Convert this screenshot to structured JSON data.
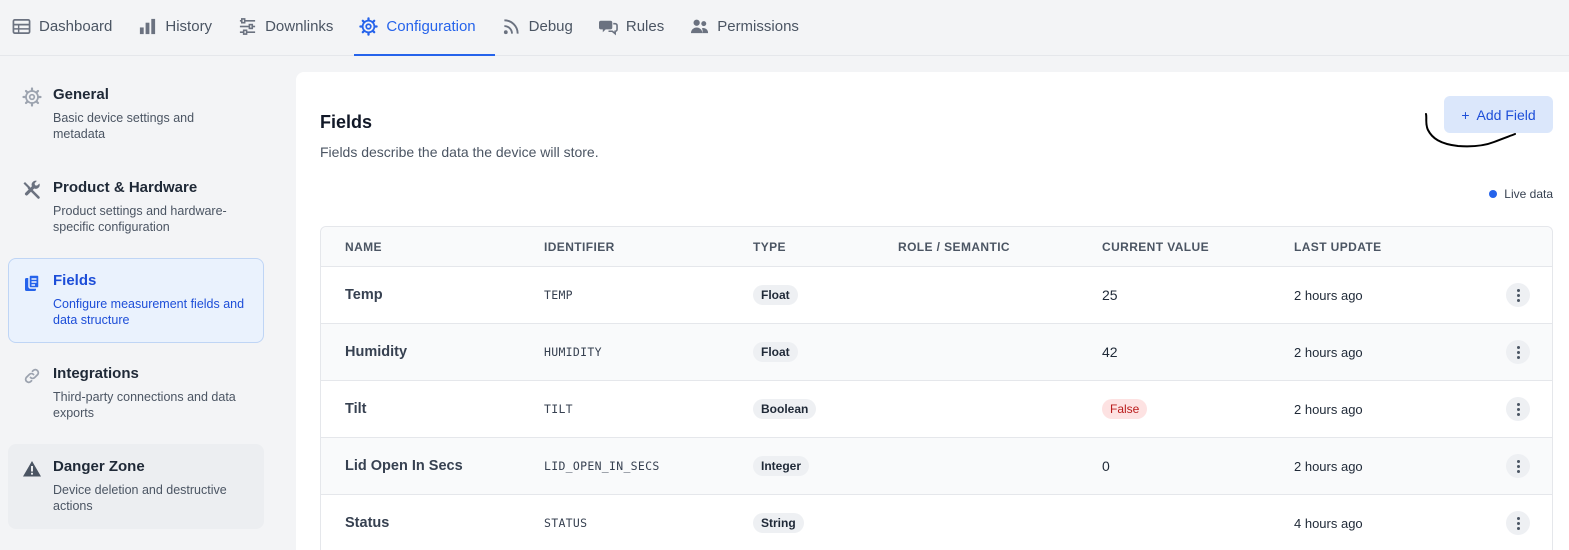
{
  "tabs": [
    {
      "label": "Dashboard",
      "icon": "table-icon",
      "active": false
    },
    {
      "label": "History",
      "icon": "bar-chart-icon",
      "active": false
    },
    {
      "label": "Downlinks",
      "icon": "sliders-icon",
      "active": false
    },
    {
      "label": "Configuration",
      "icon": "gear-icon",
      "active": true
    },
    {
      "label": "Debug",
      "icon": "rss-icon",
      "active": false
    },
    {
      "label": "Rules",
      "icon": "comments-icon",
      "active": false
    },
    {
      "label": "Permissions",
      "icon": "users-icon",
      "active": false
    }
  ],
  "sidebar": {
    "items": [
      {
        "title": "General",
        "desc": "Basic device settings and metadata",
        "icon": "gear-icon"
      },
      {
        "title": "Product & Hardware",
        "desc": "Product settings and hardware-specific configuration",
        "icon": "tools-icon"
      },
      {
        "title": "Fields",
        "desc": "Configure measurement fields and data structure",
        "icon": "fields-icon",
        "active": true
      },
      {
        "title": "Integrations",
        "desc": "Third-party connections and data exports",
        "icon": "link-icon"
      },
      {
        "title": "Danger Zone",
        "desc": "Device deletion and destructive actions",
        "icon": "warning-icon"
      }
    ]
  },
  "main": {
    "title": "Fields",
    "subtitle": "Fields describe the data the device will store.",
    "add_button": "Add Field",
    "add_button_icon": "+",
    "live_label": "Live data",
    "table": {
      "columns": [
        "NAME",
        "IDENTIFIER",
        "TYPE",
        "ROLE / SEMANTIC",
        "CURRENT VALUE",
        "LAST UPDATE"
      ],
      "rows": [
        {
          "name": "Temp",
          "identifier": "TEMP",
          "type": "Float",
          "role": "",
          "value": "25",
          "updated": "2 hours ago"
        },
        {
          "name": "Humidity",
          "identifier": "HUMIDITY",
          "type": "Float",
          "role": "",
          "value": "42",
          "updated": "2 hours ago"
        },
        {
          "name": "Tilt",
          "identifier": "TILT",
          "type": "Boolean",
          "role": "",
          "value": "False",
          "value_style": "false-pill",
          "updated": "2 hours ago"
        },
        {
          "name": "Lid Open In Secs",
          "identifier": "LID_OPEN_IN_SECS",
          "type": "Integer",
          "role": "",
          "value": "0",
          "updated": "2 hours ago"
        },
        {
          "name": "Status",
          "identifier": "STATUS",
          "type": "String",
          "role": "",
          "value": "",
          "updated": "4 hours ago"
        }
      ]
    }
  },
  "colors": {
    "accent": "#2563eb",
    "active_bg": "#eaf2fd",
    "false_bg": "#fde2e2",
    "false_text": "#b91c1c"
  }
}
